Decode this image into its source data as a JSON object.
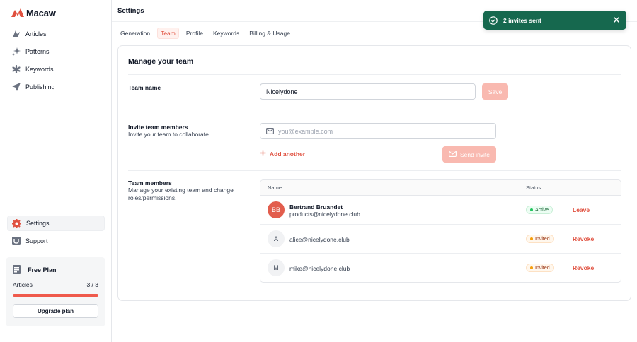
{
  "app": {
    "name": "Macaw",
    "brand_color": "#e0503f"
  },
  "sidebar": {
    "nav": [
      {
        "label": "Articles",
        "icon": "articles-icon"
      },
      {
        "label": "Patterns",
        "icon": "sparkles-icon"
      },
      {
        "label": "Keywords",
        "icon": "asterisk-icon"
      },
      {
        "label": "Publishing",
        "icon": "send-icon"
      }
    ],
    "bottom_nav": [
      {
        "label": "Settings",
        "icon": "gear-icon",
        "active": true
      },
      {
        "label": "Support",
        "icon": "support-icon"
      }
    ],
    "plan": {
      "title": "Free Plan",
      "metric_label": "Articles",
      "metric_value": "3 / 3",
      "usage_fraction": 1.0,
      "upgrade_label": "Upgrade plan"
    }
  },
  "header": {
    "title": "Settings"
  },
  "tabs": [
    {
      "label": "Generation"
    },
    {
      "label": "Team",
      "active": true
    },
    {
      "label": "Profile"
    },
    {
      "label": "Keywords"
    },
    {
      "label": "Billing & Usage"
    }
  ],
  "card": {
    "title": "Manage your team",
    "team_name": {
      "label": "Team name",
      "value": "Nicelydone",
      "save_label": "Save"
    },
    "invite": {
      "title": "Invite team members",
      "description": "Invite your team to collaborate",
      "placeholder": "you@example.com",
      "add_another_label": "Add another",
      "send_label": "Send invite"
    },
    "members": {
      "title": "Team members",
      "description": "Manage your existing team and change roles/permissions.",
      "columns": {
        "name": "Name",
        "status": "Status"
      },
      "rows": [
        {
          "avatar": "BB",
          "name": "Bertrand Bruandet",
          "email": "products@nicelydone.club",
          "status": "Active",
          "action": "Leave"
        },
        {
          "avatar": "A",
          "name": "",
          "email": "alice@nicelydone.club",
          "status": "Invited",
          "action": "Revoke"
        },
        {
          "avatar": "M",
          "name": "",
          "email": "mike@nicelydone.club",
          "status": "Invited",
          "action": "Revoke"
        }
      ]
    }
  },
  "toast": {
    "message": "2 invites sent",
    "icon": "check-circle-icon",
    "background": "#16684e"
  }
}
